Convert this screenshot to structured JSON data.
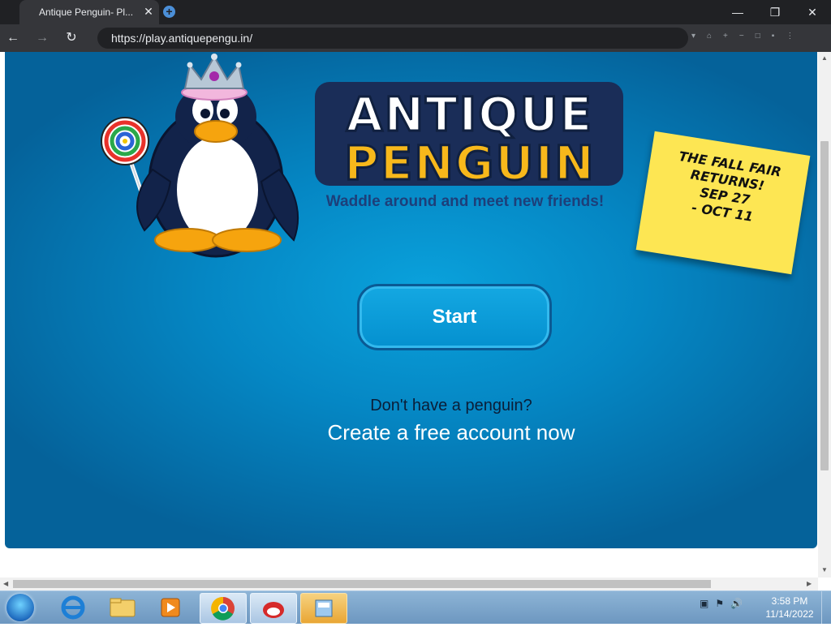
{
  "browser": {
    "tab_title": "Antique Penguin- Pl...",
    "tab_close": "✕",
    "new_tab": "+",
    "url": "https://play.antiquepengu.in/",
    "back": "←",
    "forward": "→",
    "reload": "↻",
    "minimize": "—",
    "restore": "❐",
    "close": "✕",
    "toolbar_icons": "▾⌂+−□▪⋮"
  },
  "page": {
    "logo_line1": "ANTIQUE",
    "logo_line2": "PENGUIN",
    "tagline": "Waddle around and meet new friends!",
    "start_button": "Start",
    "signup_question": "Don't have a penguin?",
    "signup_link": "Create a free account now",
    "note_text": "THE FALL FAIR\nRETURNS!\nSEP 27\n- OCT 11"
  },
  "taskbar": {
    "time": "3:58 PM",
    "date": "11/14/2022",
    "tray_icons": "▣⚑🔊"
  },
  "colors": {
    "game_bg": "#0587c4",
    "logo_yellow": "#f7b81b",
    "tagline": "#1d3f7a",
    "note_yellow": "#fde653"
  }
}
